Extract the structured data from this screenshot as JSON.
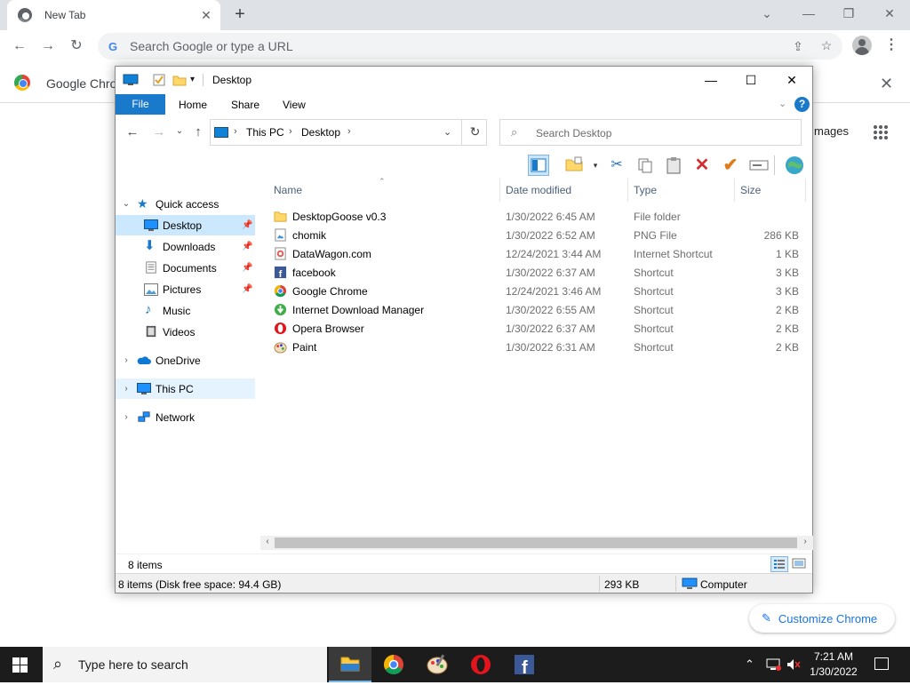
{
  "browser": {
    "tab_title": "New Tab",
    "omnibox_placeholder": "Search Google or type a URL",
    "infobar_text": "Google Chrom",
    "images_link": "mages",
    "customize_label": "Customize Chrome",
    "controls": {
      "minimize": "—",
      "restore": "❐",
      "close": "✕",
      "new_tab": "+",
      "tab_close": "✕"
    }
  },
  "explorer": {
    "title": "Desktop",
    "ribbon": {
      "file": "File",
      "tabs": [
        "Home",
        "Share",
        "View"
      ],
      "help": "?"
    },
    "address": {
      "crumbs": [
        "This PC",
        "Desktop"
      ]
    },
    "search_placeholder": "Search Desktop",
    "nav": {
      "quick_access": "Quick access",
      "quick_items": [
        "Desktop",
        "Downloads",
        "Documents",
        "Pictures",
        "Music",
        "Videos"
      ],
      "onedrive": "OneDrive",
      "this_pc": "This PC",
      "network": "Network"
    },
    "columns": {
      "name": "Name",
      "date": "Date modified",
      "type": "Type",
      "size": "Size"
    },
    "files": [
      {
        "name": "DesktopGoose v0.3",
        "date": "1/30/2022 6:45 AM",
        "type": "File folder",
        "size": "",
        "icon": "folder-icon"
      },
      {
        "name": "chomik",
        "date": "1/30/2022 6:52 AM",
        "type": "PNG File",
        "size": "286 KB",
        "icon": "image-file-icon"
      },
      {
        "name": "DataWagon.com",
        "date": "12/24/2021 3:44 AM",
        "type": "Internet Shortcut",
        "size": "1 KB",
        "icon": "web-shortcut-icon"
      },
      {
        "name": "facebook",
        "date": "1/30/2022 6:37 AM",
        "type": "Shortcut",
        "size": "3 KB",
        "icon": "facebook-icon"
      },
      {
        "name": "Google Chrome",
        "date": "12/24/2021 3:46 AM",
        "type": "Shortcut",
        "size": "3 KB",
        "icon": "chrome-icon"
      },
      {
        "name": "Internet Download Manager",
        "date": "1/30/2022 6:55 AM",
        "type": "Shortcut",
        "size": "2 KB",
        "icon": "idm-icon"
      },
      {
        "name": "Opera Browser",
        "date": "1/30/2022 6:37 AM",
        "type": "Shortcut",
        "size": "2 KB",
        "icon": "opera-icon"
      },
      {
        "name": "Paint",
        "date": "1/30/2022 6:31 AM",
        "type": "Shortcut",
        "size": "2 KB",
        "icon": "paint-icon"
      }
    ],
    "status": {
      "item_count": "8 items",
      "details": "8 items (Disk free space: 94.4 GB)",
      "size": "293 KB",
      "location": "Computer"
    }
  },
  "taskbar": {
    "search_placeholder": "Type here to search",
    "time": "7:21 AM",
    "date": "1/30/2022"
  }
}
